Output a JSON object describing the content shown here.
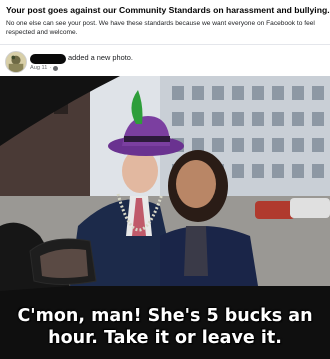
{
  "notice": {
    "title": "Your post goes against our Community Standards on harassment and bullying.",
    "body": "No one else can see your post. We have these standards because we want everyone on Facebook to feel respected and welcome."
  },
  "post": {
    "action": "added a new photo.",
    "date": "Aug 11",
    "separator": "·",
    "privacy_icon": "globe-icon"
  },
  "photo": {
    "caption_line1": "C'mon, man! She's 5 bucks an",
    "caption_line2": "hour. Take it or leave it."
  },
  "colors": {
    "hat": "#7b3fa0",
    "feather": "#2e9e3a",
    "suit": "#1c2a4a",
    "building": "#c9cfd6"
  }
}
